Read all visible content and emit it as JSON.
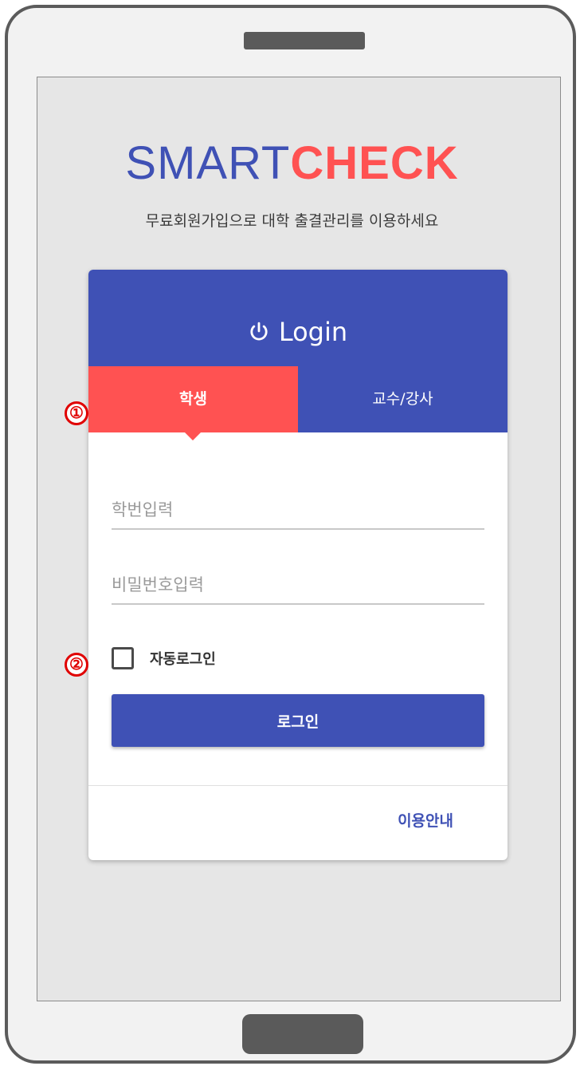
{
  "brand": {
    "part1": "SMART",
    "part2": "CHECK"
  },
  "subtitle": "무료회원가입으로 대학 출결관리를 이용하세요",
  "login_card": {
    "title": "Login",
    "icon": "power-icon",
    "tabs": [
      {
        "label": "학생",
        "active": true
      },
      {
        "label": "교수/강사",
        "active": false
      }
    ],
    "id_placeholder": "학번입력",
    "password_placeholder": "비밀번호입력",
    "auto_login_label": "자동로그인",
    "auto_login_checked": false,
    "login_button": "로그인",
    "guide_link": "이용안내"
  },
  "annotations": [
    "①",
    "②"
  ],
  "colors": {
    "primary": "#3f51b5",
    "accent": "#ff5252",
    "screen_bg": "#e6e6e6",
    "annotation": "#e00000"
  }
}
